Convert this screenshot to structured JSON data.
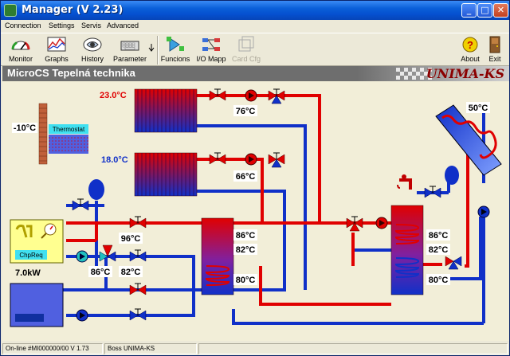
{
  "window": {
    "title": "Manager  (V 2.23)",
    "icon": "app-icon"
  },
  "menu": [
    "Connection",
    "Settings",
    "Servis",
    "Advanced"
  ],
  "toolbar": {
    "items": [
      {
        "label": "Monitor",
        "icon": "gauge-icon"
      },
      {
        "label": "Graphs",
        "icon": "graph-icon"
      },
      {
        "label": "History",
        "icon": "history-icon"
      },
      {
        "label": "Parameter",
        "icon": "keyboard-icon"
      },
      {
        "label": "Funcions",
        "icon": "functions-icon"
      },
      {
        "label": "I/O Mapp",
        "icon": "io-map-icon"
      },
      {
        "label": "Card Cfg",
        "icon": "card-icon",
        "disabled": true
      },
      {
        "label": "About",
        "icon": "help-icon"
      },
      {
        "label": "Exit",
        "icon": "exit-door-icon"
      }
    ]
  },
  "header": {
    "title": "MicroCS Tepelná technika",
    "logo": "UNIMA-KS"
  },
  "diagram": {
    "thermostat_label": "Thermostat",
    "outdoor_temp": "-10°C",
    "radiator1_temp": "23.0°C",
    "radiator2_temp": "18.0°C",
    "return1_temp": "76°C",
    "return2_temp": "66°C",
    "solar_temp": "50°C",
    "chp_label": "ChpReq",
    "chp_power": "7.0kW",
    "chp_flow_temp": "96°C",
    "chp_ret1_temp": "86°C",
    "chp_ret2_temp": "82°C",
    "tank1_top": "86°C",
    "tank1_mid": "82°C",
    "tank1_bot": "80°C",
    "tank2_top": "86°C",
    "tank2_mid": "82°C",
    "tank2_bot": "80°C",
    "colors": {
      "hot": "#E00000",
      "cold": "#1030C8",
      "label_red": "#E00000",
      "label_blue": "#1030C8"
    }
  },
  "status": [
    "On-line #MI000000/00  V 1.73",
    "Boss UNIMA-KS"
  ]
}
